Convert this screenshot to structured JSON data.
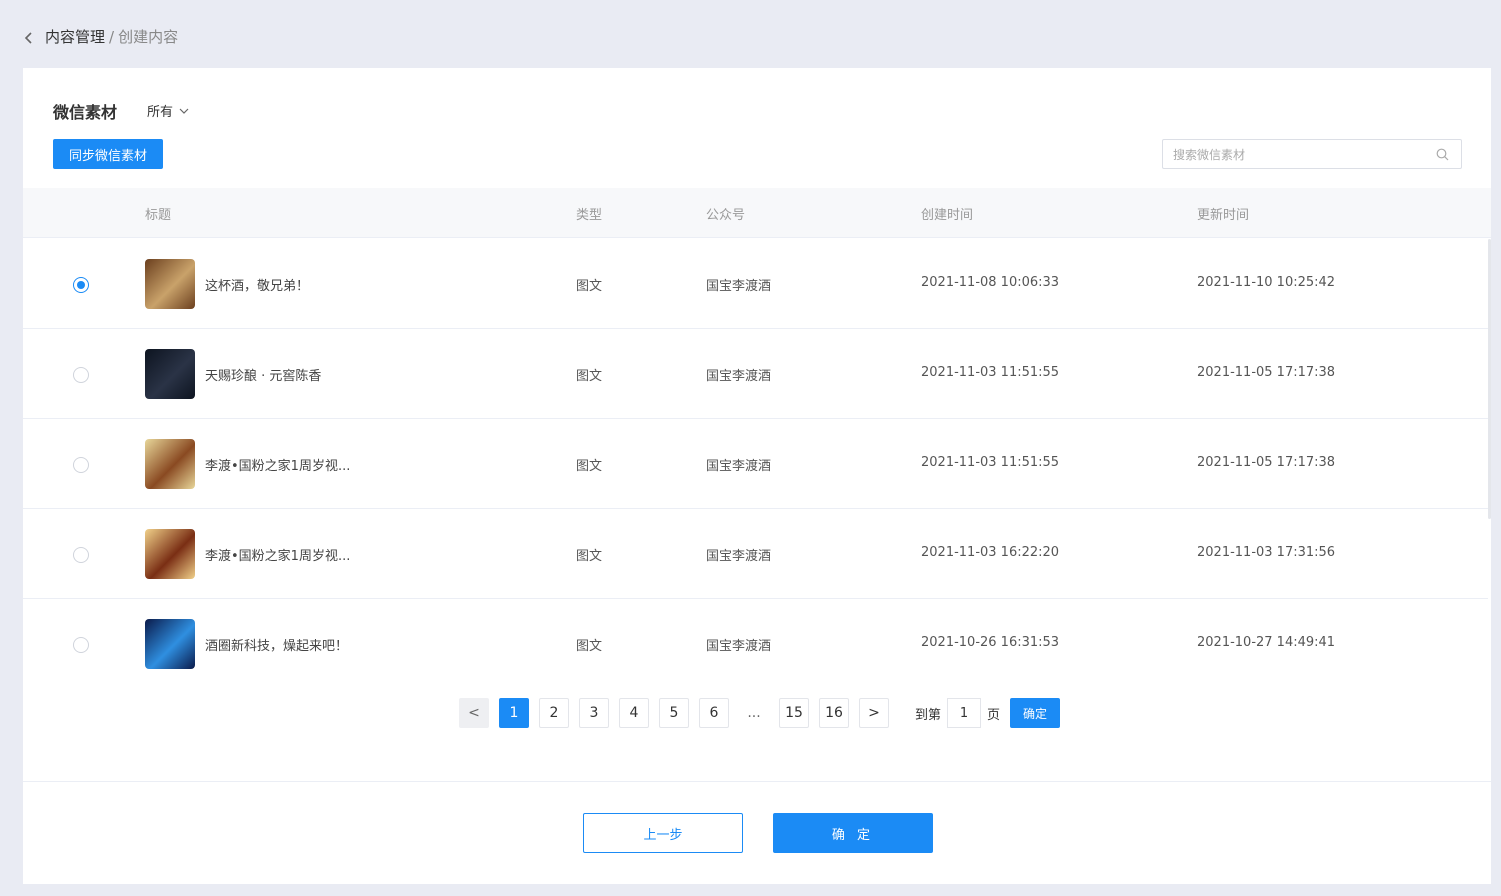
{
  "breadcrumb": {
    "parent": "内容管理",
    "separator": "/",
    "current": "创建内容"
  },
  "panel": {
    "title": "微信素材",
    "filter_label": "所有",
    "sync_button": "同步微信素材",
    "search_placeholder": "搜索微信素材"
  },
  "table": {
    "columns": {
      "title": "标题",
      "type": "类型",
      "account": "公众号",
      "created": "创建时间",
      "updated": "更新时间"
    },
    "rows": [
      {
        "selected": true,
        "title": "这杯酒，敬兄弟！",
        "type": "图文",
        "account": "国宝李渡酒",
        "created": "2021-11-08 10:06:33",
        "updated": "2021-11-10 10:25:42",
        "thumb_colors": [
          "#6b3f1e",
          "#c9a26a"
        ]
      },
      {
        "selected": false,
        "title": "天赐珍酿 · 元窖陈香",
        "type": "图文",
        "account": "国宝李渡酒",
        "created": "2021-11-03 11:51:55",
        "updated": "2021-11-05 17:17:38",
        "thumb_colors": [
          "#0d1420",
          "#2a3346"
        ]
      },
      {
        "selected": false,
        "title": "李渡•国粉之家1周岁视...",
        "type": "图文",
        "account": "国宝李渡酒",
        "created": "2021-11-03 11:51:55",
        "updated": "2021-11-05 17:17:38",
        "thumb_colors": [
          "#e8d79a",
          "#8a4a22"
        ]
      },
      {
        "selected": false,
        "title": "李渡•国粉之家1周岁视...",
        "type": "图文",
        "account": "国宝李渡酒",
        "created": "2021-11-03 16:22:20",
        "updated": "2021-11-03 17:31:56",
        "thumb_colors": [
          "#f1d18a",
          "#7a2e14"
        ]
      },
      {
        "selected": false,
        "title": "酒圈新科技，燥起来吧！",
        "type": "图文",
        "account": "国宝李渡酒",
        "created": "2021-10-26 16:31:53",
        "updated": "2021-10-27 14:49:41",
        "thumb_colors": [
          "#0a1a4a",
          "#2f8fe0"
        ]
      }
    ]
  },
  "pagination": {
    "prev": "<",
    "next": ">",
    "pages": [
      "1",
      "2",
      "3",
      "4",
      "5",
      "6",
      "...",
      "15",
      "16"
    ],
    "current": "1",
    "goto_prefix": "到第",
    "goto_value": "1",
    "goto_suffix": "页",
    "goto_button": "确定"
  },
  "footer": {
    "prev_step": "上一步",
    "confirm": "确 定"
  },
  "colors": {
    "accent": "#1b8bf5",
    "page_bg": "#e9ebf3",
    "header_bg": "#f7f8fa"
  }
}
